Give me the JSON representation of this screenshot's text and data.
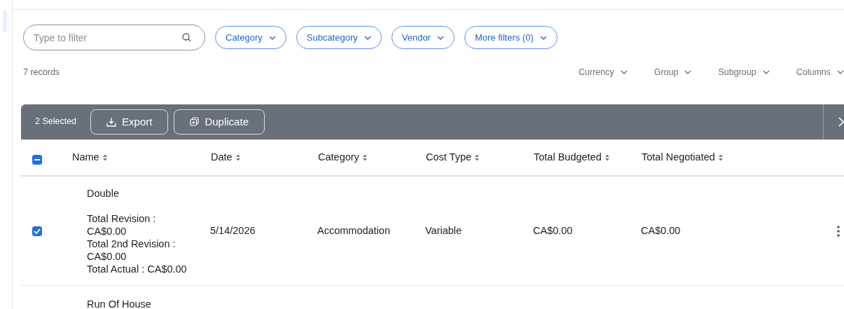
{
  "search": {
    "placeholder": "Type to filter"
  },
  "filters": [
    {
      "label": "Category"
    },
    {
      "label": "Subcategory"
    },
    {
      "label": "Vendor"
    },
    {
      "label": "More filters (0)"
    }
  ],
  "record_count": "7 records",
  "view_options": [
    "Currency",
    "Group",
    "Subgroup",
    "Columns"
  ],
  "bulk_bar": {
    "selected_count": "2 Selected",
    "actions": [
      {
        "kind": "export",
        "label": "Export"
      },
      {
        "kind": "duplicate",
        "label": "Duplicate"
      }
    ]
  },
  "table": {
    "select_all": {
      "indeterminate": true
    },
    "columns": [
      "Name",
      "Date",
      "Category",
      "Cost Type",
      "Total Budgeted",
      "Total Negotiated"
    ],
    "rows": [
      {
        "selected": true,
        "name": "Double",
        "details": [
          "Total Revision :",
          "CA$0.00",
          "Total 2nd Revision :",
          "CA$0.00",
          "Total Actual : CA$0.00"
        ],
        "cells": [
          "5/14/2026",
          "Accommodation",
          "Variable",
          "CA$0.00",
          "CA$0.00"
        ]
      },
      {
        "name": "Run Of House"
      }
    ]
  }
}
